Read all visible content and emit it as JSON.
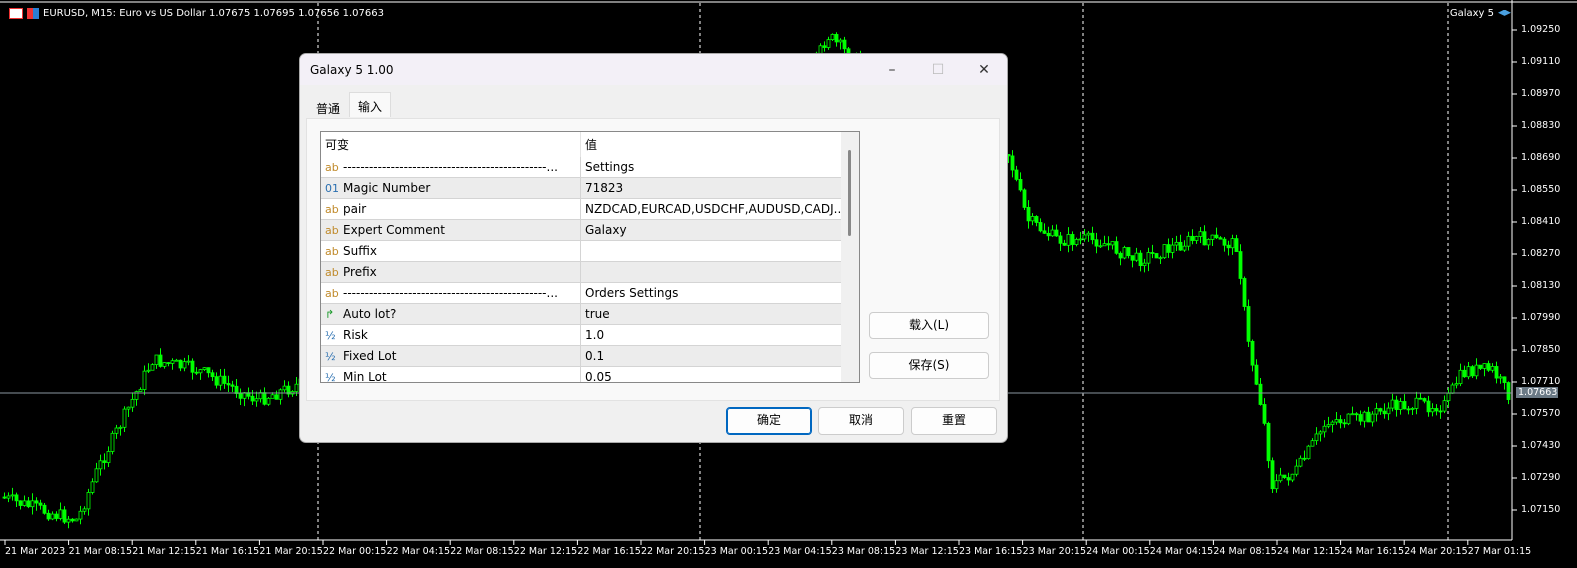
{
  "chart": {
    "symbol_line": "EURUSD, M15:  Euro vs US Dollar  1.07675 1.07695 1.07656 1.07663",
    "expert_label": "Galaxy 5",
    "expert_icon": "graduation-cap-icon",
    "current_price": "1.07663",
    "price_ticks": [
      "1.09250",
      "1.09110",
      "1.08970",
      "1.08830",
      "1.08690",
      "1.08550",
      "1.08410",
      "1.08270",
      "1.08130",
      "1.07990",
      "1.07850",
      "1.07710",
      "1.07570",
      "1.07430",
      "1.07290",
      "1.07150"
    ],
    "time_ticks": [
      "21 Mar 2023",
      "21 Mar 08:15",
      "21 Mar 12:15",
      "21 Mar 16:15",
      "21 Mar 20:15",
      "22 Mar 00:15",
      "22 Mar 04:15",
      "22 Mar 08:15",
      "22 Mar 12:15",
      "22 Mar 16:15",
      "22 Mar 20:15",
      "23 Mar 00:15",
      "23 Mar 04:15",
      "23 Mar 08:15",
      "23 Mar 12:15",
      "23 Mar 16:15",
      "23 Mar 20:15",
      "24 Mar 00:15",
      "24 Mar 04:15",
      "24 Mar 08:15",
      "24 Mar 12:15",
      "24 Mar 16:15",
      "24 Mar 20:15",
      "27 Mar 01:15"
    ],
    "candle_color": "#00ff00"
  },
  "dialog": {
    "title": "Galaxy 5 1.00",
    "tabs": [
      {
        "label": "普通"
      },
      {
        "label": "输入"
      }
    ],
    "columns": {
      "name": "可变",
      "value": "值"
    },
    "rows": [
      {
        "type": "ab",
        "name": "-----------------------------------------------...",
        "value": "Settings"
      },
      {
        "type": "01",
        "name": "Magic Number",
        "value": "71823"
      },
      {
        "type": "ab",
        "name": "pair",
        "value": "NZDCAD,EURCAD,USDCHF,AUDUSD,CADJ..."
      },
      {
        "type": "ab",
        "name": "Expert Comment",
        "value": "Galaxy"
      },
      {
        "type": "ab",
        "name": "Suffix",
        "value": ""
      },
      {
        "type": "ab",
        "name": "Prefix",
        "value": ""
      },
      {
        "type": "ab",
        "name": "-----------------------------------------------...",
        "value": "Orders Settings"
      },
      {
        "type": "bool",
        "name": "Auto lot?",
        "value": "true"
      },
      {
        "type": "½",
        "name": "Risk",
        "value": "1.0"
      },
      {
        "type": "½",
        "name": "Fixed Lot",
        "value": "0.1"
      },
      {
        "type": "½",
        "name": "Min Lot",
        "value": "0.05"
      }
    ],
    "load_label": "载入(L)",
    "save_label": "保存(S)",
    "ok_label": "确定",
    "cancel_label": "取消",
    "reset_label": "重置"
  }
}
